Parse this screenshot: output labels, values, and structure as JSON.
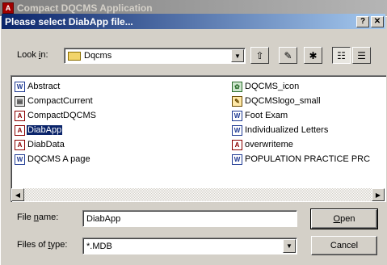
{
  "app": {
    "title": "Compact DQCMS Application",
    "icon": "access-app-icon",
    "icon_glyph": "A"
  },
  "dialog": {
    "title": "Please select DiabApp file...",
    "help_glyph": "?",
    "close_glyph": "✕"
  },
  "lookin": {
    "label_pre": "Look ",
    "label_key": "i",
    "label_post": "n:",
    "value": "Dqcms"
  },
  "toolbar": {
    "up_glyph": "⇧",
    "desktop_glyph": "✎",
    "newfolder_glyph": "✱",
    "list_glyph": "☷",
    "details_glyph": "☰"
  },
  "files": [
    {
      "name": "Abstract",
      "type": "word",
      "glyph": "W",
      "selected": false
    },
    {
      "name": "CompactCurrent",
      "type": "app",
      "glyph": "▤",
      "selected": false
    },
    {
      "name": "CompactDQCMS",
      "type": "access",
      "glyph": "A",
      "selected": false
    },
    {
      "name": "DiabApp",
      "type": "access",
      "glyph": "A",
      "selected": true
    },
    {
      "name": "DiabData",
      "type": "access",
      "glyph": "A",
      "selected": false
    },
    {
      "name": "DQCMS A page",
      "type": "word",
      "glyph": "W",
      "selected": false
    },
    {
      "name": "DQCMS_icon",
      "type": "img",
      "glyph": "✿",
      "selected": false
    },
    {
      "name": "DQCMSlogo_small",
      "type": "img2",
      "glyph": "✎",
      "selected": false
    },
    {
      "name": "Foot Exam",
      "type": "word",
      "glyph": "W",
      "selected": false
    },
    {
      "name": "Individualized Letters",
      "type": "word",
      "glyph": "W",
      "selected": false
    },
    {
      "name": "overwriteme",
      "type": "access",
      "glyph": "A",
      "selected": false
    },
    {
      "name": "POPULATION PRACTICE PRC",
      "type": "word",
      "glyph": "W",
      "selected": false
    }
  ],
  "scroll": {
    "left_glyph": "◀",
    "right_glyph": "▶"
  },
  "filename": {
    "label_pre": "File ",
    "label_key": "n",
    "label_post": "ame:",
    "value": "DiabApp"
  },
  "filetype": {
    "label_pre": "Files of ",
    "label_key": "t",
    "label_post": "ype:",
    "value": "*.MDB",
    "arrow_glyph": "▼"
  },
  "buttons": {
    "open_key": "O",
    "open_rest": "pen",
    "cancel": "Cancel"
  }
}
